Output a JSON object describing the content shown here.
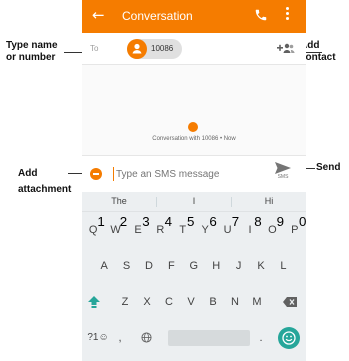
{
  "appbar": {
    "title": "Conversation",
    "back_icon": "←"
  },
  "recipient": {
    "to_label": "To",
    "chip_number": "10086"
  },
  "conversation": {
    "meta": "Conversation with 10086 • Now"
  },
  "compose": {
    "placeholder": "Type an SMS message",
    "send_sublabel": "SMS"
  },
  "keyboard": {
    "suggestions": [
      "The",
      "I",
      "Hi"
    ],
    "row1": [
      {
        "k": "Q",
        "n": "1"
      },
      {
        "k": "W",
        "n": "2"
      },
      {
        "k": "E",
        "n": "3"
      },
      {
        "k": "R",
        "n": "4"
      },
      {
        "k": "T",
        "n": "5"
      },
      {
        "k": "Y",
        "n": "6"
      },
      {
        "k": "U",
        "n": "7"
      },
      {
        "k": "I",
        "n": "8"
      },
      {
        "k": "O",
        "n": "9"
      },
      {
        "k": "P",
        "n": "0"
      }
    ],
    "row2": [
      "A",
      "S",
      "D",
      "F",
      "G",
      "H",
      "J",
      "K",
      "L"
    ],
    "row3": [
      "Z",
      "X",
      "C",
      "V",
      "B",
      "N",
      "M"
    ],
    "row4": {
      "symbols": "?1☺",
      "comma": ",",
      "period": "."
    }
  },
  "annotations": {
    "type_name": [
      "Type  name",
      "or number"
    ],
    "add_contact": [
      "Add",
      "contact"
    ],
    "add_attachment": [
      "Add",
      "attachment"
    ],
    "send": "Send"
  },
  "colors": {
    "accent": "#f57c00",
    "emoji": "#26a69a",
    "shift": "#26a69a"
  }
}
